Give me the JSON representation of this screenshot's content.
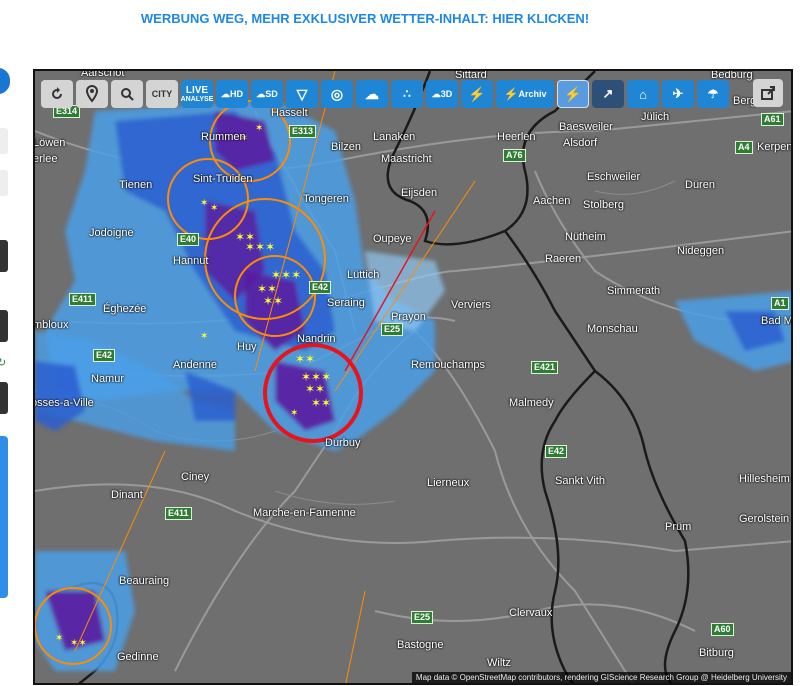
{
  "banner": {
    "text": "WERBUNG WEG, MEHR EXKLUSIVER WETTER-INHALT: HIER KLICKEN!"
  },
  "toolbar": {
    "reload_icon": "reload-icon",
    "location_icon": "location-pin-icon",
    "zoom_icon": "zoom-icon",
    "city_label": "CITY",
    "live_label": "LIVE",
    "live_sub": "ANALYSE",
    "hd_label": "HD",
    "sd_label": "SD",
    "d3_label": "3D",
    "archiv_label": "Archiv",
    "colors": {
      "blue": "#1f86d6",
      "grey": "#d4d4d4",
      "active": "#5a9be0"
    }
  },
  "map": {
    "cities": [
      {
        "name": "Aarschot"
      },
      {
        "name": "Hasselt"
      },
      {
        "name": "Sittard"
      },
      {
        "name": "Bedburg"
      },
      {
        "name": "Bergheim"
      },
      {
        "name": "Rummen"
      },
      {
        "name": "Lanaken"
      },
      {
        "name": "Heerlen"
      },
      {
        "name": "Baesweiler"
      },
      {
        "name": "Jülich"
      },
      {
        "name": "Löwen"
      },
      {
        "name": "Bilzen"
      },
      {
        "name": "Maastricht"
      },
      {
        "name": "Alsdorf"
      },
      {
        "name": "Kerpen"
      },
      {
        "name": "erlee"
      },
      {
        "name": "Tienen"
      },
      {
        "name": "Sint-Truiden"
      },
      {
        "name": "Eschweiler"
      },
      {
        "name": "Düren"
      },
      {
        "name": "Tongeren"
      },
      {
        "name": "Eijsden"
      },
      {
        "name": "Aachen"
      },
      {
        "name": "Stolberg"
      },
      {
        "name": "Jodoigne"
      },
      {
        "name": "Oupeye"
      },
      {
        "name": "Nütheim"
      },
      {
        "name": "Nideggen"
      },
      {
        "name": "Hannut"
      },
      {
        "name": "Raeren"
      },
      {
        "name": "Lüttich"
      },
      {
        "name": "Simmerath"
      },
      {
        "name": "Éghezée"
      },
      {
        "name": "Seraing"
      },
      {
        "name": "Verviers"
      },
      {
        "name": "mbloux"
      },
      {
        "name": "Prayon"
      },
      {
        "name": "Bad M"
      },
      {
        "name": "Monschau"
      },
      {
        "name": "Huy"
      },
      {
        "name": "Nandrin"
      },
      {
        "name": "Andenne"
      },
      {
        "name": "Remouchamps"
      },
      {
        "name": "Namur"
      },
      {
        "name": "Malmedy"
      },
      {
        "name": "osses-a-Ville"
      },
      {
        "name": "Durbuy"
      },
      {
        "name": "Ciney"
      },
      {
        "name": "Lierneux"
      },
      {
        "name": "Sankt Vith"
      },
      {
        "name": "Hillesheim"
      },
      {
        "name": "Dinant"
      },
      {
        "name": "Marche-en-Famenne"
      },
      {
        "name": "Gerolstein"
      },
      {
        "name": "Prüm"
      },
      {
        "name": "Beauraing"
      },
      {
        "name": "Clervaux"
      },
      {
        "name": "Bastogne"
      },
      {
        "name": "Bitburg"
      },
      {
        "name": "Gedinne"
      },
      {
        "name": "Wiltz"
      }
    ],
    "roads": [
      {
        "name": "E314"
      },
      {
        "name": "E313"
      },
      {
        "name": "A76"
      },
      {
        "name": "A61"
      },
      {
        "name": "A4"
      },
      {
        "name": "E40"
      },
      {
        "name": "E42"
      },
      {
        "name": "E411"
      },
      {
        "name": "E25"
      },
      {
        "name": "A1"
      },
      {
        "name": "E42"
      },
      {
        "name": "E421"
      },
      {
        "name": "E42"
      },
      {
        "name": "E411"
      },
      {
        "name": "E25"
      },
      {
        "name": "A60"
      }
    ],
    "attribution": "Map data © OpenStreetMap contributors, rendering GIScience Research Group @ Heidelberg University",
    "colors": {
      "land": "#6f6f6f",
      "rain_light": "#4a9fe8",
      "rain_mid": "#2a5fd0",
      "rain_heavy": "#5a1ea0",
      "strike": "#ffff33",
      "cell_ring": "#ff8c00",
      "warn_ring": "#e8141c"
    }
  }
}
